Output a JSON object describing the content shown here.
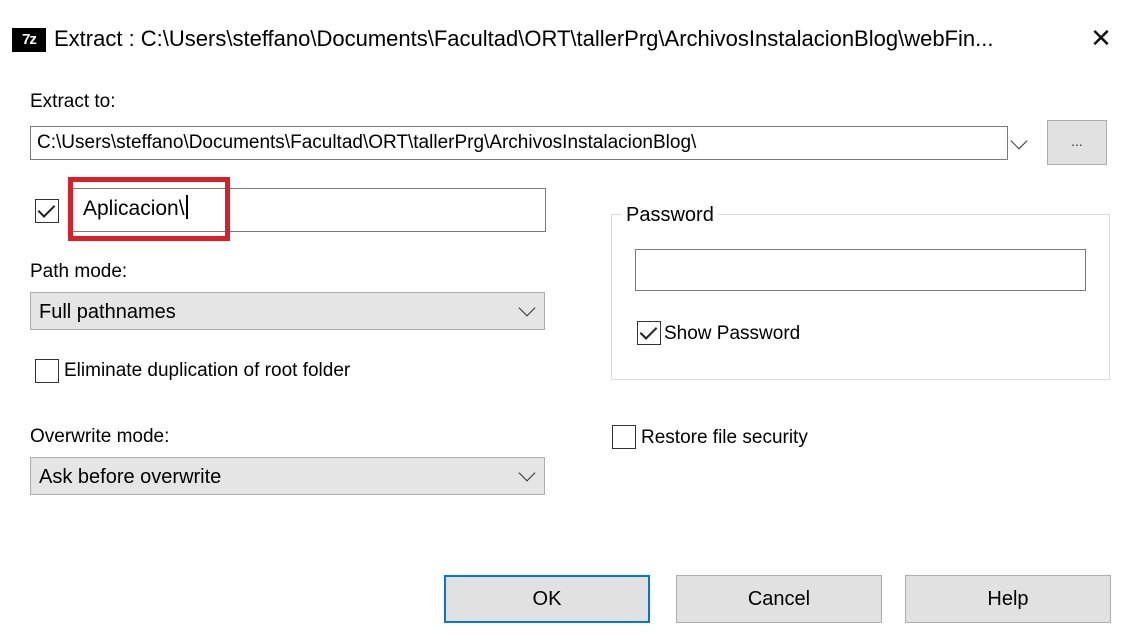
{
  "window": {
    "app_icon_text": "7z",
    "title": "Extract : C:\\Users\\steffano\\Documents\\Facultad\\ORT\\tallerPrg\\ArchivosInstalacionBlog\\webFin...",
    "close_glyph": "✕"
  },
  "extract_to": {
    "label": "Extract to:",
    "path": "C:\\Users\\steffano\\Documents\\Facultad\\ORT\\tallerPrg\\ArchivosInstalacionBlog\\",
    "browse_label": "..."
  },
  "subfolder": {
    "checked": true,
    "value": "Aplicacion\\"
  },
  "path_mode": {
    "label": "Path mode:",
    "selected": "Full pathnames"
  },
  "eliminate_duplication": {
    "label": "Eliminate duplication of root folder",
    "checked": false
  },
  "overwrite_mode": {
    "label": "Overwrite mode:",
    "selected": "Ask before overwrite"
  },
  "password": {
    "group_label": "Password",
    "value": "",
    "show_password_label": "Show Password",
    "show_password_checked": true
  },
  "restore_security": {
    "label": "Restore file security",
    "checked": false
  },
  "buttons": {
    "ok": "OK",
    "cancel": "Cancel",
    "help": "Help"
  },
  "colors": {
    "highlight": "#d8202a",
    "default_button_border": "#0078d7"
  }
}
